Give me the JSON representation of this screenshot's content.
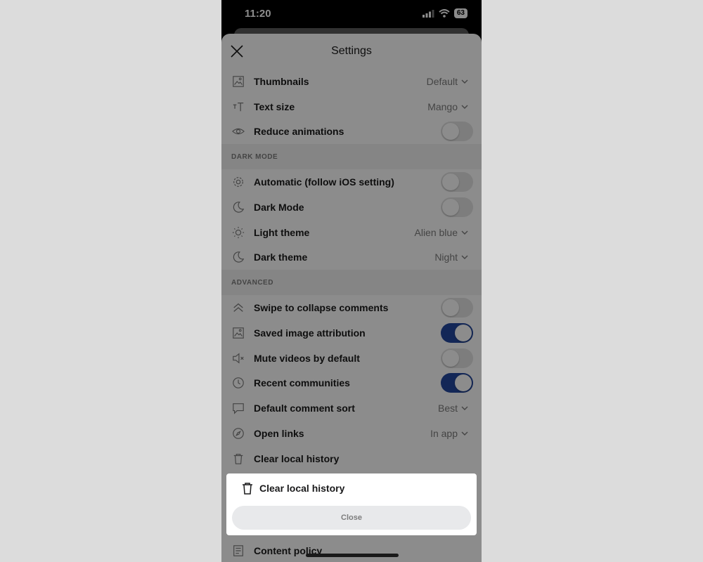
{
  "status": {
    "time": "11:20",
    "battery": "63"
  },
  "sheet": {
    "title": "Settings"
  },
  "rows_top": [
    {
      "label": "Thumbnails",
      "value": "Default",
      "icon": "image-icon",
      "kind": "select"
    },
    {
      "label": "Text size",
      "value": "Mango",
      "icon": "text-size-icon",
      "kind": "select"
    },
    {
      "label": "Reduce animations",
      "icon": "eye-icon",
      "kind": "toggle",
      "on": false
    }
  ],
  "sections": {
    "dark_mode": "DARK MODE",
    "advanced": "ADVANCED"
  },
  "rows_dark": [
    {
      "label": "Automatic (follow iOS setting)",
      "icon": "gear-icon",
      "kind": "toggle",
      "on": false
    },
    {
      "label": "Dark Mode",
      "icon": "moon-icon",
      "kind": "toggle",
      "on": false
    },
    {
      "label": "Light theme",
      "value": "Alien blue",
      "icon": "sun-icon",
      "kind": "select"
    },
    {
      "label": "Dark theme",
      "value": "Night",
      "icon": "moon-icon",
      "kind": "select"
    }
  ],
  "rows_adv": [
    {
      "label": "Swipe to collapse comments",
      "icon": "chevrons-up-icon",
      "kind": "toggle",
      "on": false
    },
    {
      "label": "Saved image attribution",
      "icon": "image-icon",
      "kind": "toggle",
      "on": true
    },
    {
      "label": "Mute videos by default",
      "icon": "speaker-mute-icon",
      "kind": "toggle",
      "on": false
    },
    {
      "label": "Recent communities",
      "icon": "clock-icon",
      "kind": "toggle",
      "on": true
    },
    {
      "label": "Default comment sort",
      "value": "Best",
      "icon": "comment-icon",
      "kind": "select"
    },
    {
      "label": "Open links",
      "value": "In app",
      "icon": "compass-icon",
      "kind": "select"
    },
    {
      "label": "Clear local history",
      "icon": "trash-icon",
      "kind": "action"
    }
  ],
  "rows_bottom": [
    {
      "label": "Content policy",
      "icon": "document-icon",
      "kind": "action"
    }
  ],
  "popup": {
    "label": "Clear local history",
    "close": "Close"
  },
  "colors": {
    "toggle_on": "#24489e",
    "toggle_off": "#e4e4e4",
    "section_bg": "#f2f2f2"
  }
}
